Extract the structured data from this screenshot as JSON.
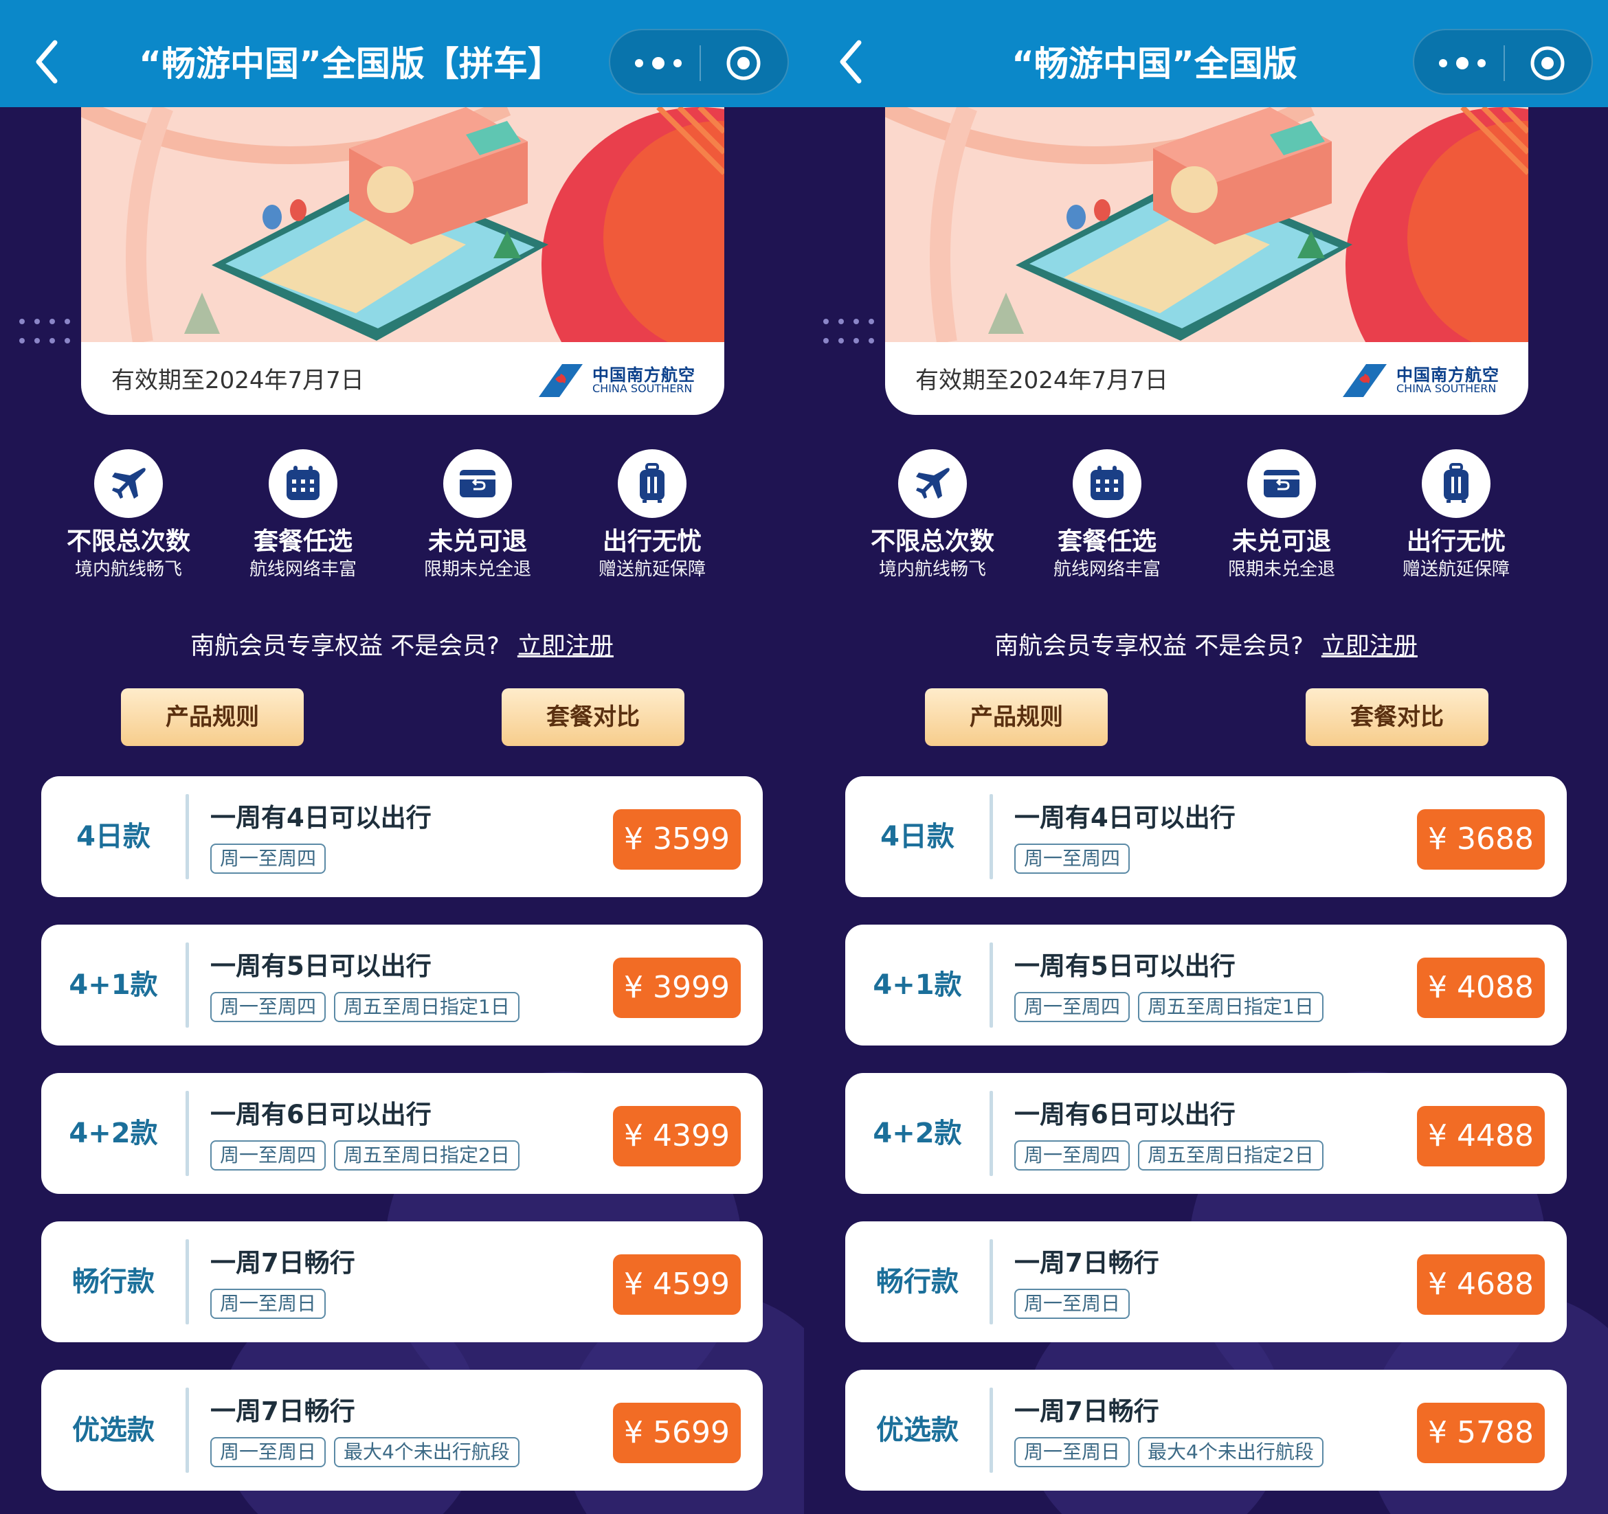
{
  "screens": [
    {
      "nav": {
        "title": "“畅游中国”全国版【拼车】"
      },
      "banner": {
        "validity": "有效期至2024年7月7日",
        "airline_cn": "中国南方航空",
        "airline_en": "CHINA SOUTHERN"
      },
      "features": [
        {
          "name": "不限总次数",
          "desc": "境内航线畅飞",
          "icon": "airplane-icon"
        },
        {
          "name": "套餐任选",
          "desc": "航线网络丰富",
          "icon": "calendar-icon"
        },
        {
          "name": "未兑可退",
          "desc": "限期未兑全退",
          "icon": "refund-card-icon"
        },
        {
          "name": "出行无忧",
          "desc": "赠送航延保障",
          "icon": "suitcase-icon"
        }
      ],
      "member": {
        "text": "南航会员专享权益 不是会员?",
        "register": "立即注册"
      },
      "buttons": {
        "rules": "产品规则",
        "compare": "套餐对比"
      },
      "products": [
        {
          "name": "4日款",
          "desc": "一周有4日可以出行",
          "tags": [
            "周一至周四"
          ],
          "price": "¥ 3599"
        },
        {
          "name": "4+1款",
          "desc": "一周有5日可以出行",
          "tags": [
            "周一至周四",
            "周五至周日指定1日"
          ],
          "price": "¥ 3999"
        },
        {
          "name": "4+2款",
          "desc": "一周有6日可以出行",
          "tags": [
            "周一至周四",
            "周五至周日指定2日"
          ],
          "price": "¥ 4399"
        },
        {
          "name": "畅行款",
          "desc": "一周7日畅行",
          "tags": [
            "周一至周日"
          ],
          "price": "¥ 4599"
        },
        {
          "name": "优选款",
          "desc": "一周7日畅行",
          "tags": [
            "周一至周日",
            "最大4个未出行航段"
          ],
          "price": "¥ 5699"
        }
      ]
    },
    {
      "nav": {
        "title": "“畅游中国”全国版"
      },
      "banner": {
        "validity": "有效期至2024年7月7日",
        "airline_cn": "中国南方航空",
        "airline_en": "CHINA SOUTHERN"
      },
      "features": [
        {
          "name": "不限总次数",
          "desc": "境内航线畅飞",
          "icon": "airplane-icon"
        },
        {
          "name": "套餐任选",
          "desc": "航线网络丰富",
          "icon": "calendar-icon"
        },
        {
          "name": "未兑可退",
          "desc": "限期未兑全退",
          "icon": "refund-card-icon"
        },
        {
          "name": "出行无忧",
          "desc": "赠送航延保障",
          "icon": "suitcase-icon"
        }
      ],
      "member": {
        "text": "南航会员专享权益 不是会员?",
        "register": "立即注册"
      },
      "buttons": {
        "rules": "产品规则",
        "compare": "套餐对比"
      },
      "products": [
        {
          "name": "4日款",
          "desc": "一周有4日可以出行",
          "tags": [
            "周一至周四"
          ],
          "price": "¥ 3688"
        },
        {
          "name": "4+1款",
          "desc": "一周有5日可以出行",
          "tags": [
            "周一至周四",
            "周五至周日指定1日"
          ],
          "price": "¥ 4088"
        },
        {
          "name": "4+2款",
          "desc": "一周有6日可以出行",
          "tags": [
            "周一至周四",
            "周五至周日指定2日"
          ],
          "price": "¥ 4488"
        },
        {
          "name": "畅行款",
          "desc": "一周7日畅行",
          "tags": [
            "周一至周日"
          ],
          "price": "¥ 4688"
        },
        {
          "name": "优选款",
          "desc": "一周7日畅行",
          "tags": [
            "周一至周日",
            "最大4个未出行航段"
          ],
          "price": "¥ 5788"
        }
      ]
    }
  ],
  "colors": {
    "navbar": "#0b88c9",
    "background": "#1f1452",
    "price": "#f26c25",
    "product_name": "#1b6f9a",
    "button_gold": "#f7cd8c"
  }
}
